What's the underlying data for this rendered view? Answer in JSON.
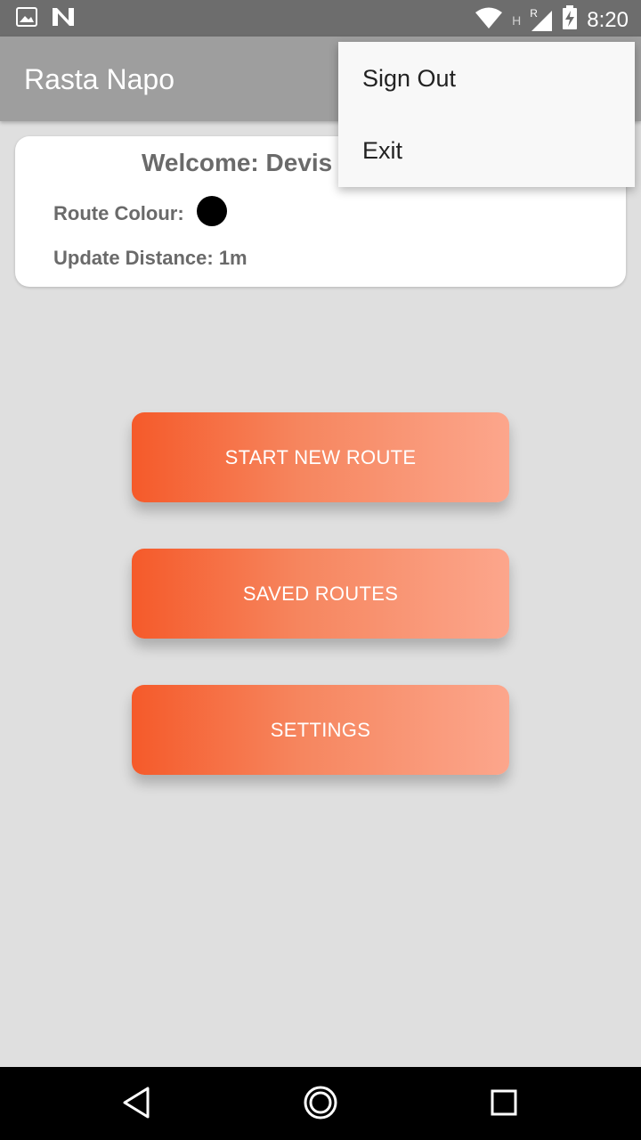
{
  "status_bar": {
    "time": "8:20",
    "indicator_letters": [
      "H",
      "R"
    ],
    "icons": [
      "image-icon",
      "n-icon",
      "wifi-icon",
      "signal-icon",
      "battery-charging-icon"
    ]
  },
  "app_bar": {
    "title": "Rasta Napo"
  },
  "card": {
    "welcome_text": "Welcome: Devis",
    "route_colour_label": "Route Colour:",
    "route_colour": "#000000",
    "update_distance_label": "Update Distance: 1m"
  },
  "buttons": {
    "start_new_route": "START NEW ROUTE",
    "saved_routes": "SAVED ROUTES",
    "settings": "SETTINGS"
  },
  "menu": {
    "items": [
      "Sign Out",
      "Exit"
    ]
  },
  "nav_bar": {
    "icons": [
      "back-icon",
      "home-icon",
      "recents-icon"
    ]
  },
  "colors": {
    "button_gradient_start": "#f55a2a",
    "button_gradient_end": "#fca68c",
    "app_bar": "#9e9e9e",
    "background": "#dfdfdf"
  }
}
